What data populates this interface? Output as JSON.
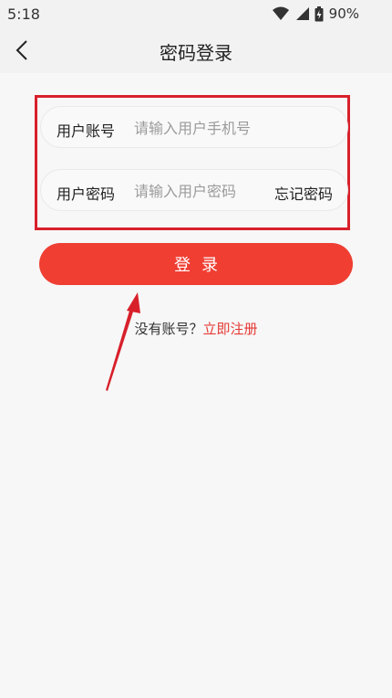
{
  "status_bar": {
    "time": "5:18",
    "battery": "90%",
    "icons": [
      "wifi-icon",
      "signal-icon",
      "battery-icon"
    ]
  },
  "nav": {
    "title": "密码登录",
    "back_icon": "chevron-left-icon"
  },
  "form": {
    "account_label": "用户账号",
    "account_placeholder": "请输入用户手机号",
    "password_label": "用户密码",
    "password_placeholder": "请输入用户密码",
    "forgot_label": "忘记密码"
  },
  "login_button_label": "登录",
  "register": {
    "prompt": "没有账号？",
    "link": "立即注册"
  },
  "colors": {
    "accent": "#f03e33",
    "highlight_frame": "#d8202b",
    "link": "#e53935",
    "background": "#f7f7f7"
  }
}
